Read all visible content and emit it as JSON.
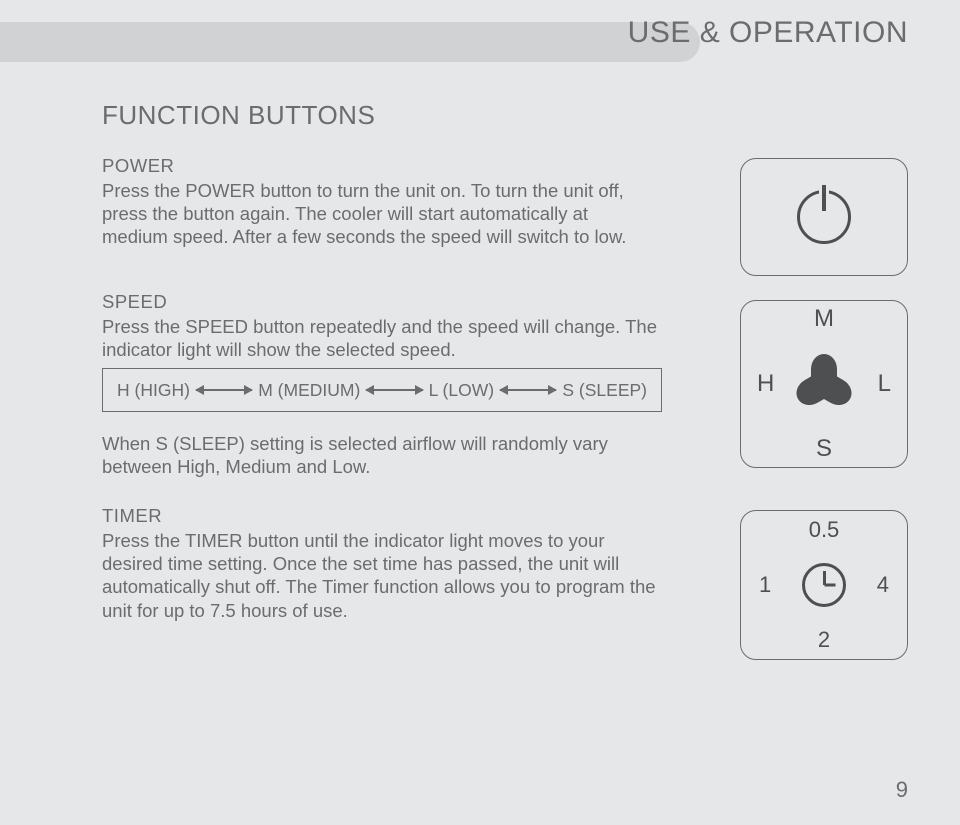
{
  "header": {
    "title": "USE & OPERATION"
  },
  "section_title": "FUNCTION BUTTONS",
  "power": {
    "heading": "POWER",
    "body": "Press the POWER button to turn the unit on. To turn the unit off, press the button again. The cooler will start automatically at medium speed. After a few seconds the speed will switch to low."
  },
  "speed": {
    "heading": "SPEED",
    "body": "Press the SPEED button repeatedly and the speed will change. The indicator light will show the selected speed.",
    "flow": [
      "H (HIGH)",
      "M (MEDIUM)",
      "L (LOW)",
      "S (SLEEP)"
    ],
    "sleep_note": "When S (SLEEP) setting is selected airflow will randomly vary between High, Medium and Low.",
    "labels": {
      "top": "M",
      "left": "H",
      "right": "L",
      "bottom": "S"
    }
  },
  "timer": {
    "heading": "TIMER",
    "body": "Press the TIMER button until the indicator light moves to your desired time setting. Once the set time has passed, the unit will automatically shut off. The Timer function allows you to program the unit for up to 7.5 hours of use.",
    "labels": {
      "top": "0.5",
      "left": "1",
      "right": "4",
      "bottom": "2"
    }
  },
  "page_number": "9"
}
